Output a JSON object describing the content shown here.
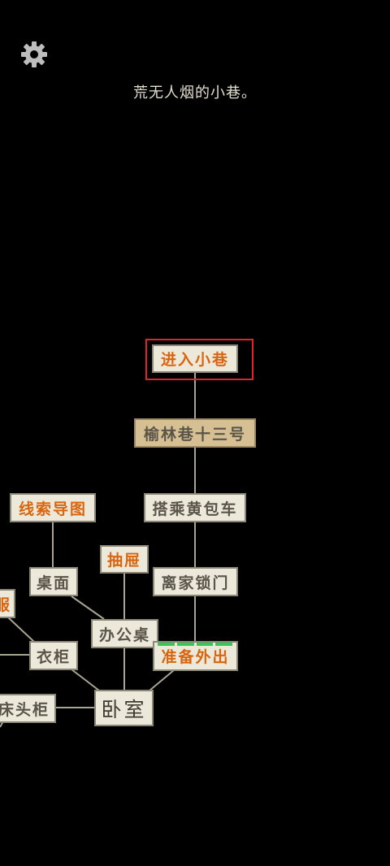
{
  "scene": {
    "caption": "荒无人烟的小巷。"
  },
  "icons": {
    "settings": "gear-icon"
  },
  "colors": {
    "background": "#000000",
    "node_fill": "#ece8da",
    "node_fill_tan": "#d5bf93",
    "text_orange": "#d9650f",
    "text_gray": "#5a5548",
    "highlight_red": "#d9262a",
    "progress_green": "#34c759",
    "link_line": "#a9a595"
  },
  "nodes": {
    "enter_alley": "进入小巷",
    "yulin_13": "榆林巷十三号",
    "rickshaw": "搭乘黄包车",
    "clue_map": "线索导图",
    "drawer": "抽屉",
    "desk_surface": "桌面",
    "lock_door": "离家锁门",
    "clothes_partial": "服",
    "office_desk": "办公桌",
    "wardrobe": "衣柜",
    "prepare_out": "准备外出",
    "nightstand": "床头柜",
    "bedroom": "卧室"
  },
  "progress": {
    "prepare_out_segments": 4
  }
}
